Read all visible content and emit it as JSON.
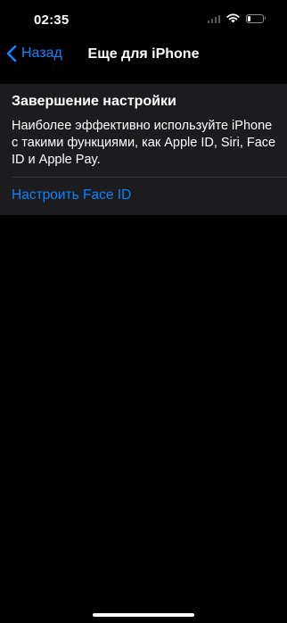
{
  "status_bar": {
    "time": "02:35",
    "icons": [
      "cellular-signal-icon",
      "wifi-icon",
      "battery-icon"
    ],
    "battery_level": 0.2
  },
  "nav": {
    "back_label": "Назад",
    "title": "Еще для iPhone"
  },
  "card": {
    "title": "Завершение настройки",
    "description": "Наиболее эффективно используйте iPhone с такими функциями, как Apple ID, Siri, Face ID и Apple Pay.",
    "action_label": "Настроить Face ID"
  },
  "colors": {
    "background": "#000000",
    "card": "#1c1c1e",
    "accent": "#0a84ff",
    "text": "#ffffff",
    "divider": "#38383a"
  }
}
